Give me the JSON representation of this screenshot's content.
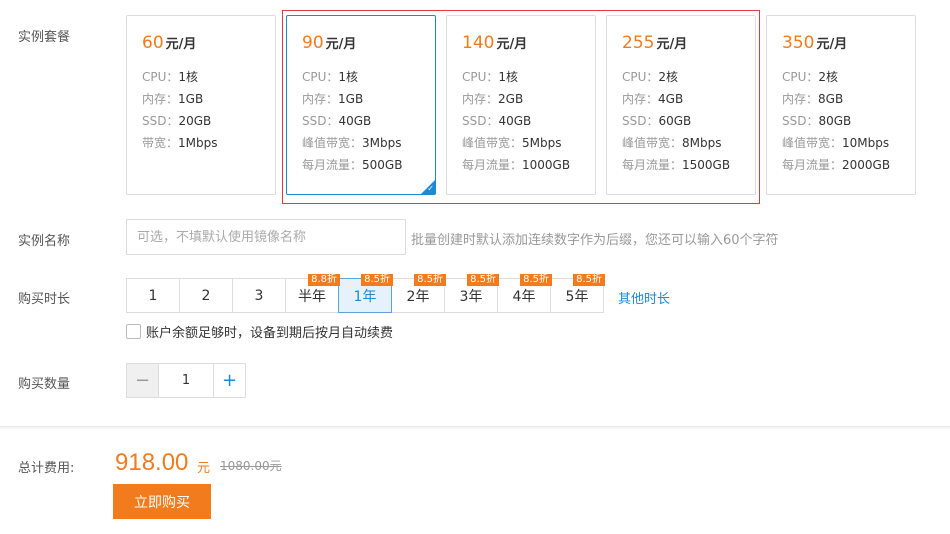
{
  "labels": {
    "plan": "实例套餐",
    "name": "实例名称",
    "duration": "购买时长",
    "quantity": "购买数量",
    "total": "总计费用:"
  },
  "plans": [
    {
      "price": "60",
      "unit": "元/月",
      "specs": [
        {
          "k": "CPU：",
          "v": "1核"
        },
        {
          "k": "内存：",
          "v": "1GB"
        },
        {
          "k": "SSD：",
          "v": "20GB"
        },
        {
          "k": "带宽：",
          "v": "1Mbps"
        }
      ]
    },
    {
      "price": "90",
      "unit": "元/月",
      "selected": true,
      "specs": [
        {
          "k": "CPU：",
          "v": "1核"
        },
        {
          "k": "内存：",
          "v": "1GB"
        },
        {
          "k": "SSD：",
          "v": "40GB"
        },
        {
          "k": "峰值带宽：",
          "v": "3Mbps"
        },
        {
          "k": "每月流量：",
          "v": "500GB"
        }
      ]
    },
    {
      "price": "140",
      "unit": "元/月",
      "specs": [
        {
          "k": "CPU：",
          "v": "1核"
        },
        {
          "k": "内存：",
          "v": "2GB"
        },
        {
          "k": "SSD：",
          "v": "40GB"
        },
        {
          "k": "峰值带宽：",
          "v": "5Mbps"
        },
        {
          "k": "每月流量：",
          "v": "1000GB"
        }
      ]
    },
    {
      "price": "255",
      "unit": "元/月",
      "specs": [
        {
          "k": "CPU：",
          "v": "2核"
        },
        {
          "k": "内存：",
          "v": "4GB"
        },
        {
          "k": "SSD：",
          "v": "60GB"
        },
        {
          "k": "峰值带宽：",
          "v": "8Mbps"
        },
        {
          "k": "每月流量：",
          "v": "1500GB"
        }
      ]
    },
    {
      "price": "350",
      "unit": "元/月",
      "specs": [
        {
          "k": "CPU：",
          "v": "2核"
        },
        {
          "k": "内存：",
          "v": "8GB"
        },
        {
          "k": "SSD：",
          "v": "80GB"
        },
        {
          "k": "峰值带宽：",
          "v": "10Mbps"
        },
        {
          "k": "每月流量：",
          "v": "2000GB"
        }
      ]
    }
  ],
  "name_input": {
    "placeholder": "可选，不填默认使用镜像名称",
    "value": "",
    "hint": "批量创建时默认添加连续数字作为后缀，您还可以输入60个字符"
  },
  "durations": [
    {
      "label": "1",
      "badge": ""
    },
    {
      "label": "2",
      "badge": ""
    },
    {
      "label": "3",
      "badge": ""
    },
    {
      "label": "半年",
      "badge": "8.8折"
    },
    {
      "label": "1年",
      "badge": "8.5折",
      "active": true
    },
    {
      "label": "2年",
      "badge": "8.5折"
    },
    {
      "label": "3年",
      "badge": "8.5折"
    },
    {
      "label": "4年",
      "badge": "8.5折"
    },
    {
      "label": "5年",
      "badge": "8.5折"
    }
  ],
  "other_duration": "其他时长",
  "auto_renew": {
    "label": "账户余额足够时，设备到期后按月自动续费",
    "checked": false
  },
  "quantity": {
    "value": "1",
    "minus": "−",
    "plus": "+"
  },
  "total": {
    "price": "918.00",
    "unit": "元",
    "original": "1080.00元"
  },
  "buy_button": "立即购买",
  "colors": {
    "accent": "#f27b1d",
    "link": "#1a8ad6",
    "highlight": "#e2383f"
  },
  "icons": {
    "checkmark": "checkmark-icon",
    "minus": "minus-icon",
    "plus": "plus-icon"
  }
}
